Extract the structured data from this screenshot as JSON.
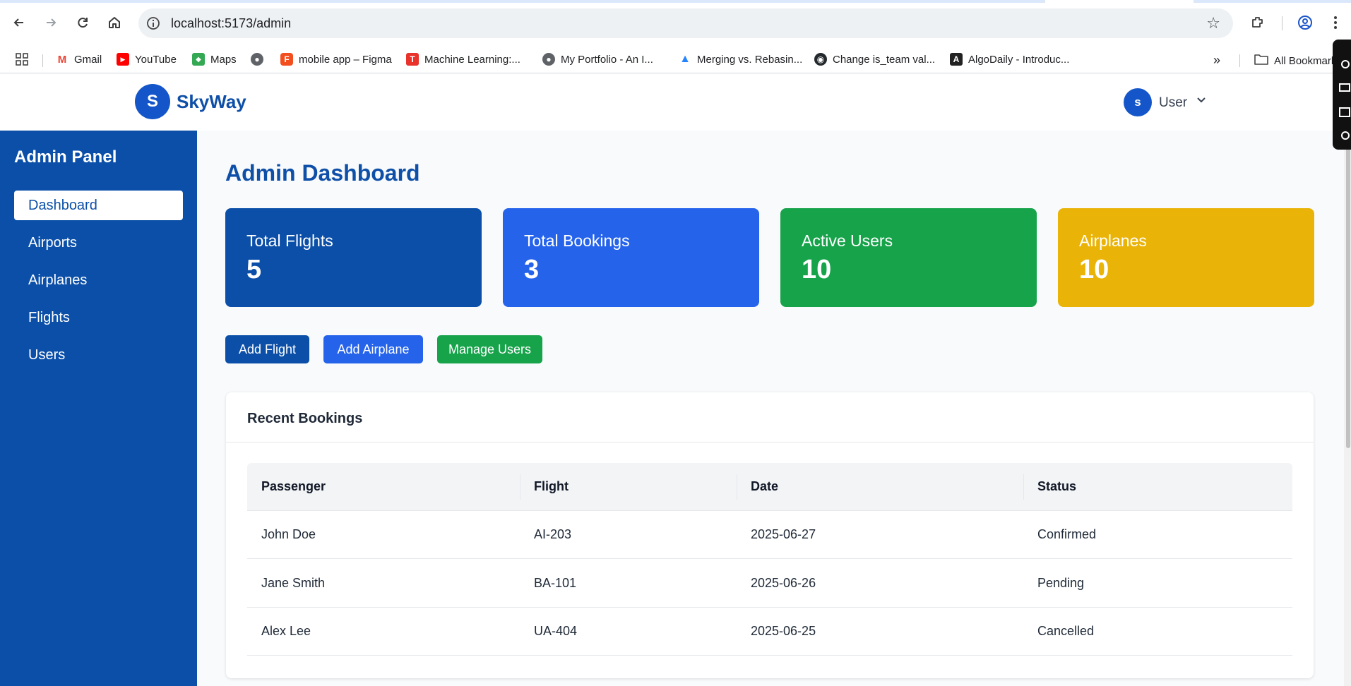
{
  "browser": {
    "url": "localhost:5173/admin",
    "bookmarks": [
      {
        "label": "Gmail",
        "icon": "gmail-icon"
      },
      {
        "label": "YouTube",
        "icon": "youtube-icon"
      },
      {
        "label": "Maps",
        "icon": "maps-icon"
      },
      {
        "label": "",
        "icon": "globe-icon"
      },
      {
        "label": "mobile app – Figma",
        "icon": "figma-icon"
      },
      {
        "label": "Machine Learning:...",
        "icon": "tensorflow-icon"
      },
      {
        "label": "My Portfolio - An I...",
        "icon": "globe-icon"
      },
      {
        "label": "Merging vs. Rebasin...",
        "icon": "atlassian-icon"
      },
      {
        "label": "Change is_team val...",
        "icon": "github-icon"
      },
      {
        "label": "AlgoDaily - Introduc...",
        "icon": "algodaily-icon"
      }
    ],
    "all_bookmarks_label": "All Bookmarks"
  },
  "header": {
    "logo_letter": "S",
    "brand": "SkyWay",
    "user_initial": "s",
    "user_label": "User"
  },
  "sidebar": {
    "title": "Admin Panel",
    "items": [
      {
        "label": "Dashboard",
        "active": true
      },
      {
        "label": "Airports"
      },
      {
        "label": "Airplanes"
      },
      {
        "label": "Flights"
      },
      {
        "label": "Users"
      }
    ]
  },
  "main": {
    "title": "Admin Dashboard",
    "stats": [
      {
        "label": "Total Flights",
        "value": "5",
        "color": "#0b4fa8"
      },
      {
        "label": "Total Bookings",
        "value": "3",
        "color": "#2563eb"
      },
      {
        "label": "Active Users",
        "value": "10",
        "color": "#16a34a"
      },
      {
        "label": "Airplanes",
        "value": "10",
        "color": "#eab308"
      }
    ],
    "actions": [
      {
        "label": "Add Flight",
        "color": "#0b4fa8"
      },
      {
        "label": "Add Airplane",
        "color": "#2563eb"
      },
      {
        "label": "Manage Users",
        "color": "#16a34a"
      }
    ],
    "recent_bookings": {
      "title": "Recent Bookings",
      "columns": [
        "Passenger",
        "Flight",
        "Date",
        "Status"
      ],
      "rows": [
        [
          "John Doe",
          "AI-203",
          "2025-06-27",
          "Confirmed"
        ],
        [
          "Jane Smith",
          "BA-101",
          "2025-06-26",
          "Pending"
        ],
        [
          "Alex Lee",
          "UA-404",
          "2025-06-25",
          "Cancelled"
        ]
      ]
    }
  }
}
